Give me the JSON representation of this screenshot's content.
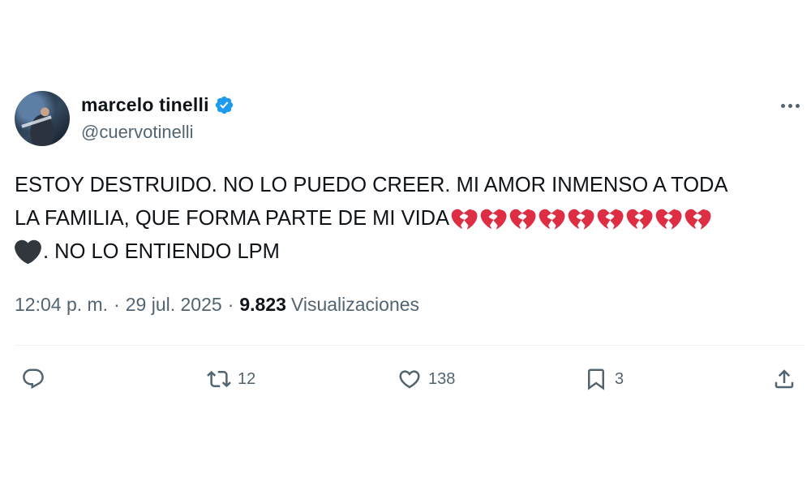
{
  "author": {
    "display_name": "marcelo tinelli",
    "handle": "@cuervotinelli",
    "verified": true,
    "verified_color": "#1d9bf0"
  },
  "tweet": {
    "line1": "ESTOY DESTRUIDO. NO LO PUEDO CREER. MI AMOR INMENSO A TODA",
    "line2": "LA FAMILIA, QUE FORMA PARTE DE MI VIDA",
    "broken_hearts_count": 9,
    "line3": ". NO LO ENTIENDO LPM",
    "emoji": [
      "broken-heart-icon",
      "black-heart-icon"
    ]
  },
  "meta": {
    "time": "12:04 p. m.",
    "separator": "·",
    "date": "29 jul. 2025",
    "views_count": "9.823",
    "views_label": "Visualizaciones"
  },
  "actions": {
    "reply_count": "",
    "retweet_count": "12",
    "like_count": "138",
    "bookmark_count": "3"
  },
  "colors": {
    "text": "#0f1419",
    "secondary": "#536471",
    "broken_heart": "#dd2e44",
    "black_heart": "#31373d"
  }
}
